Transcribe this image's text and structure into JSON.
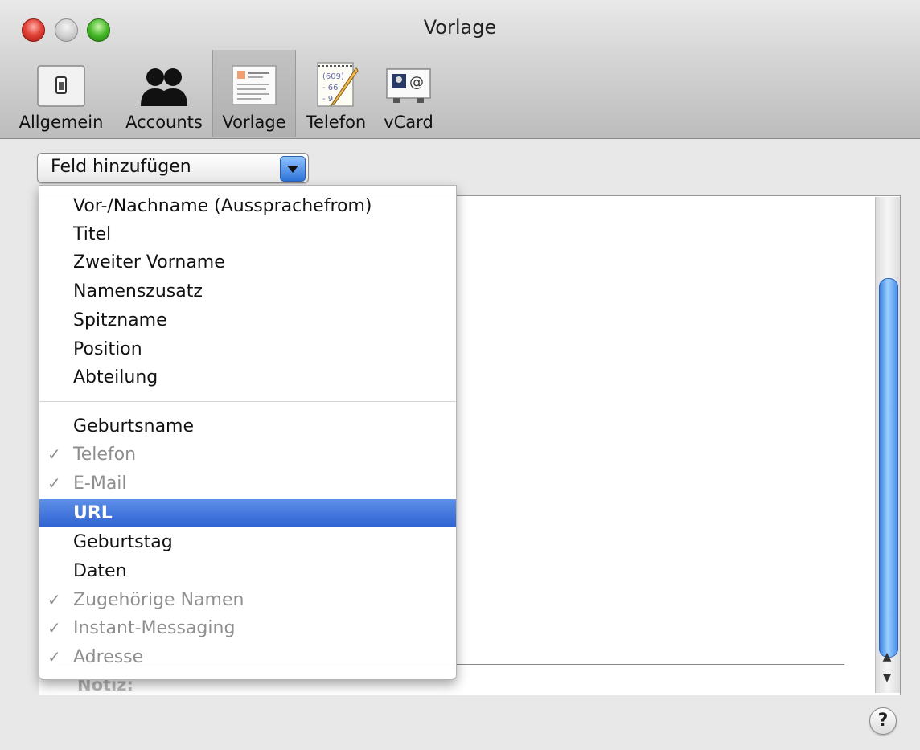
{
  "window": {
    "title": "Vorlage"
  },
  "toolbar": [
    {
      "label": "Allgemein",
      "icon": "switch-icon",
      "selected": false
    },
    {
      "label": "Accounts",
      "icon": "users-icon",
      "selected": false
    },
    {
      "label": "Vorlage",
      "icon": "card-template-icon",
      "selected": true
    },
    {
      "label": "Telefon",
      "icon": "phone-notepad-icon",
      "selected": false
    },
    {
      "label": "vCard",
      "icon": "vcard-icon",
      "selected": false
    }
  ],
  "popup": {
    "label": "Feld hinzufügen"
  },
  "menu": {
    "group1": [
      "Vor-/Nachname (Aussprachefrom)",
      "Titel",
      "Zweiter Vorname",
      "Namenszusatz",
      "Spitzname",
      "Position",
      "Abteilung"
    ],
    "group2": [
      {
        "label": "Geburtsname",
        "checked": false,
        "disabled": false,
        "highlighted": false
      },
      {
        "label": "Telefon",
        "checked": true,
        "disabled": true,
        "highlighted": false
      },
      {
        "label": "E-Mail",
        "checked": true,
        "disabled": true,
        "highlighted": false
      },
      {
        "label": "URL",
        "checked": false,
        "disabled": false,
        "highlighted": true
      },
      {
        "label": "Geburtstag",
        "checked": false,
        "disabled": false,
        "highlighted": false
      },
      {
        "label": "Daten",
        "checked": false,
        "disabled": false,
        "highlighted": false
      },
      {
        "label": "Zugehörige Namen",
        "checked": true,
        "disabled": true,
        "highlighted": false
      },
      {
        "label": "Instant-Messaging",
        "checked": true,
        "disabled": true,
        "highlighted": false
      },
      {
        "label": "Adresse",
        "checked": true,
        "disabled": true,
        "highlighted": false
      }
    ],
    "check_glyph": "✓"
  },
  "background": {
    "notiz_label": "Notiz:"
  },
  "help": {
    "label": "?"
  },
  "scroll": {
    "up": "▲",
    "down": "▼"
  }
}
